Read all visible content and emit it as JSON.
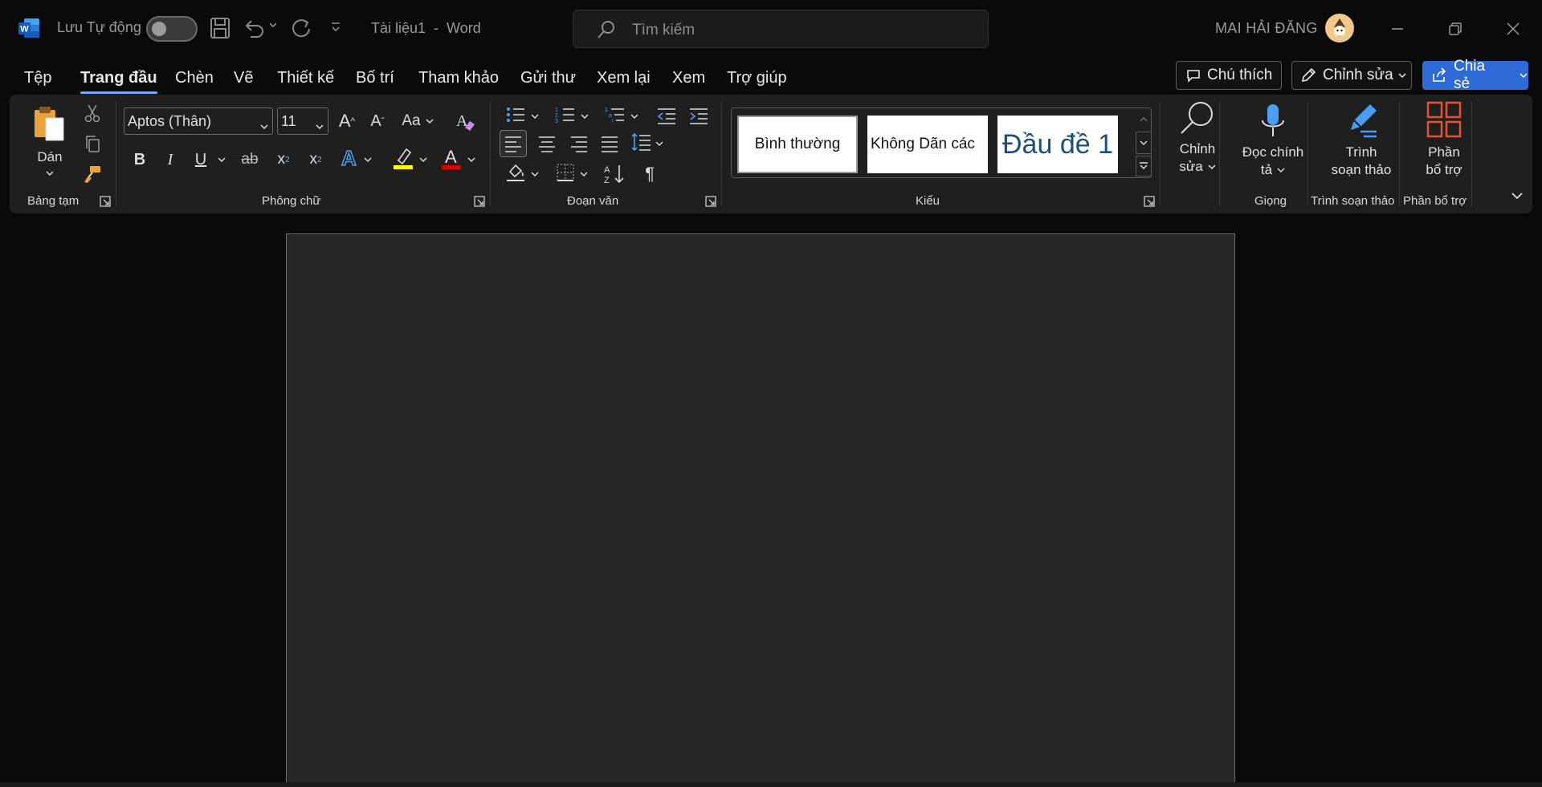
{
  "app": {
    "autosave_label": "Lưu Tự động",
    "doc_title": "Tài liệu1  -  Word",
    "search_placeholder": "Tìm kiếm",
    "user_name": "MAI HẢI ĐĂNG",
    "autosave_on": false
  },
  "tabs": [
    "Tệp",
    "Trang đầu",
    "Chèn",
    "Vẽ",
    "Thiết kế",
    "Bố trí",
    "Tham khảo",
    "Gửi thư",
    "Xem lại",
    "Xem",
    "Trợ giúp"
  ],
  "active_tab": "Trang đầu",
  "actions": {
    "comments": "Chú thích",
    "editing": "Chỉnh sửa",
    "share": "Chia sẻ"
  },
  "clipboard": {
    "paste": "Dán",
    "group": "Bảng tạm"
  },
  "font": {
    "name": "Aptos (Thân)",
    "size": "11",
    "change_case": "Aa",
    "group": "Phông chữ",
    "highlight_color": "#ffff00",
    "font_color": "#e00000"
  },
  "paragraph": {
    "group": "Đoạn văn"
  },
  "styles": {
    "items": [
      "Bình thường",
      "Không Dãn các",
      "Đầu đề 1"
    ],
    "group": "Kiểu",
    "heading_color": "#1f4e79"
  },
  "editing_group": {
    "label_1": "Chỉnh",
    "label_2": "sửa"
  },
  "voice": {
    "label_1": "Đọc chính",
    "label_2": "tả",
    "group": "Giọng"
  },
  "editor": {
    "label_1": "Trình",
    "label_2": "soạn thảo",
    "group": "Trình soạn thảo"
  },
  "addins": {
    "label_1": "Phần",
    "label_2": "bổ trợ",
    "group": "Phần bổ trợ"
  },
  "colors": {
    "accent": "#2e6bd8",
    "active_tab_underline": "#6ab0f3",
    "page": "#262626",
    "background": "#0a0a0a"
  }
}
